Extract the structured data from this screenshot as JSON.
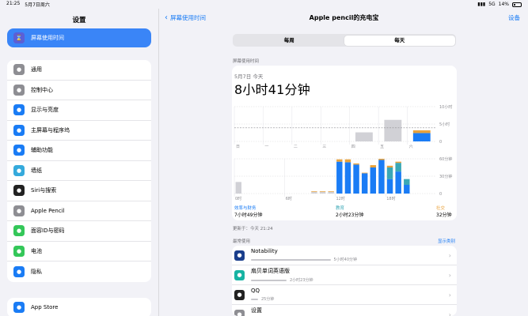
{
  "status": {
    "time": "21:25",
    "date": "5月7日周六",
    "signal": "5G",
    "battery": "14%"
  },
  "sidebar": {
    "title": "设置",
    "selected": {
      "label": "屏幕使用时间",
      "icon": "hourglass-icon",
      "color": "#5b5fd6"
    },
    "group1": [
      {
        "label": "通用",
        "icon": "gear-icon",
        "color": "#8e8e93"
      },
      {
        "label": "控制中心",
        "icon": "switches-icon",
        "color": "#8e8e93"
      },
      {
        "label": "显示与亮度",
        "icon": "aa-icon",
        "color": "#1a7cf5"
      },
      {
        "label": "主屏幕与程序坞",
        "icon": "grid-icon",
        "color": "#1a7cf5"
      },
      {
        "label": "辅助功能",
        "icon": "accessibility-icon",
        "color": "#1a7cf5"
      },
      {
        "label": "墙纸",
        "icon": "flower-icon",
        "color": "#35aadc"
      },
      {
        "label": "Siri与搜索",
        "icon": "siri-icon",
        "color": "#222222"
      },
      {
        "label": "Apple Pencil",
        "icon": "pencil-icon",
        "color": "#8e8e93"
      },
      {
        "label": "面容ID与密码",
        "icon": "faceid-icon",
        "color": "#34c759"
      },
      {
        "label": "电池",
        "icon": "battery-icon",
        "color": "#34c759"
      },
      {
        "label": "隐私",
        "icon": "hand-icon",
        "color": "#1a7cf5"
      }
    ],
    "group2": [
      {
        "label": "App Store",
        "icon": "appstore-icon",
        "color": "#1a7cf5"
      }
    ]
  },
  "nav": {
    "back_label": "屏幕使用时间",
    "title": "Apple pencil的充电宝",
    "right_label": "设备"
  },
  "segment": {
    "week": "每周",
    "day": "每天"
  },
  "screen_time_label": "屏幕使用时间",
  "summary": {
    "date": "5月7日 今天",
    "total": "8小时41分钟"
  },
  "chart_data": [
    {
      "type": "bar",
      "categories": [
        "日",
        "一",
        "二",
        "三",
        "四",
        "五",
        "六"
      ],
      "values": [
        0,
        0,
        0,
        0,
        2.6,
        6.2,
        3.2
      ],
      "ylim": [
        0,
        10
      ],
      "yticks": [
        "10小时",
        "5小时",
        "0"
      ],
      "average_label": "平均",
      "colors": {
        "past": "#d1d1d6",
        "today_social": "#e9a23b",
        "today_edu": "#3aa8b6",
        "today_work": "#1a7cf5"
      }
    },
    {
      "type": "bar",
      "x_labels": [
        "0时",
        "6时",
        "12时",
        "18时"
      ],
      "yticks": [
        "60分钟",
        "30分钟",
        "0"
      ],
      "ylim": [
        0,
        60
      ],
      "series": [
        {
          "name": "效率与财务",
          "values": [
            20,
            0,
            0,
            0,
            0,
            0,
            0,
            0,
            0,
            3,
            3,
            3,
            0,
            0,
            0,
            0,
            0,
            0,
            0,
            0,
            0,
            0,
            0,
            0
          ]
        },
        {
          "name": "教育",
          "values": [
            0,
            0,
            0,
            0,
            0,
            0,
            0,
            0,
            0,
            0,
            0,
            0,
            0,
            0,
            0,
            0,
            0,
            0,
            0,
            0,
            0,
            0,
            0,
            0
          ]
        },
        {
          "name": "社交",
          "values": [
            0,
            0,
            0,
            0,
            0,
            0,
            0,
            0,
            0,
            1,
            1,
            1,
            0,
            0,
            0,
            0,
            0,
            0,
            0,
            0,
            0,
            0,
            0,
            0
          ]
        }
      ],
      "today_hours": [
        {
          "h": 12,
          "work": 55,
          "edu": 0,
          "soc": 4
        },
        {
          "h": 13,
          "work": 54,
          "edu": 0,
          "soc": 5
        },
        {
          "h": 14,
          "work": 50,
          "edu": 0,
          "soc": 2
        },
        {
          "h": 15,
          "work": 35,
          "edu": 0,
          "soc": 1
        },
        {
          "h": 16,
          "work": 45,
          "edu": 0,
          "soc": 4
        },
        {
          "h": 17,
          "work": 58,
          "edu": 0,
          "soc": 2
        },
        {
          "h": 18,
          "work": 25,
          "edu": 20,
          "soc": 3
        },
        {
          "h": 19,
          "work": 38,
          "edu": 15,
          "soc": 2
        },
        {
          "h": 20,
          "work": 15,
          "edu": 10,
          "soc": 0
        }
      ]
    }
  ],
  "legend": [
    {
      "category": "效率与财务",
      "time": "7小时49分钟"
    },
    {
      "category": "教育",
      "time": "2小时23分钟"
    },
    {
      "category": "社交",
      "time": "32分钟"
    }
  ],
  "updated": "更新于：今天 21:24",
  "most_used": {
    "label": "最常使用",
    "show_categories": "显示类别"
  },
  "apps": [
    {
      "name": "Notability",
      "time": "5小时40分钟",
      "bar_fraction": 0.65,
      "icon": "notability-icon",
      "color": "#1a3e8c"
    },
    {
      "name": "扇贝单词英语版",
      "time": "2小时23分钟",
      "bar_fraction": 0.28,
      "icon": "shanbay-icon",
      "color": "#17b3a3"
    },
    {
      "name": "QQ",
      "time": "25分钟",
      "bar_fraction": 0.04,
      "icon": "qq-icon",
      "color": "#222222"
    },
    {
      "name": "设置",
      "time": "5分钟",
      "bar_fraction": 0.02,
      "icon": "settings-icon",
      "color": "#8e8e93"
    }
  ]
}
